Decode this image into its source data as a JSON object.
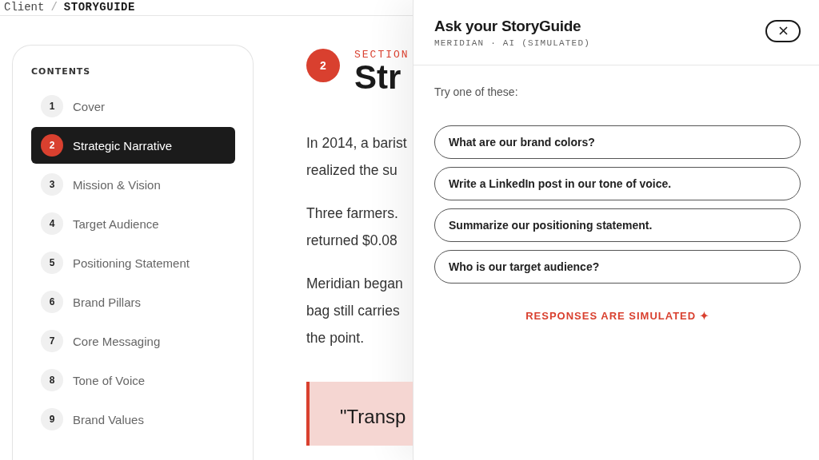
{
  "breadcrumb": {
    "parent": "Client",
    "separator": "/",
    "current": "STORYGUIDE"
  },
  "contents": {
    "title": "CONTENTS",
    "items": [
      {
        "number": "1",
        "label": "Cover",
        "selected": false
      },
      {
        "number": "2",
        "label": "Strategic Narrative",
        "selected": true
      },
      {
        "number": "3",
        "label": "Mission & Vision",
        "selected": false
      },
      {
        "number": "4",
        "label": "Target Audience",
        "selected": false
      },
      {
        "number": "5",
        "label": "Positioning Statement",
        "selected": false
      },
      {
        "number": "6",
        "label": "Brand Pillars",
        "selected": false
      },
      {
        "number": "7",
        "label": "Core Messaging",
        "selected": false
      },
      {
        "number": "8",
        "label": "Tone of Voice",
        "selected": false
      },
      {
        "number": "9",
        "label": "Brand Values",
        "selected": false
      }
    ]
  },
  "section": {
    "number": "2",
    "eyebrow": "SECTION",
    "title": "Str",
    "paragraphs": [
      [
        "In 2014, a barist",
        "realized the su"
      ],
      [
        "Three farmers.",
        "returned $0.08"
      ],
      [
        "Meridian began",
        "bag still carries",
        "the point."
      ]
    ],
    "quote": "\"Transp"
  },
  "assistant": {
    "title": "Ask your StoryGuide",
    "subtitle": "MERIDIAN · AI (SIMULATED)",
    "prompt": "Try one of these:",
    "suggestions": [
      "What are our brand colors?",
      "Write a LinkedIn post in our tone of voice.",
      "Summarize our positioning statement.",
      "Who is our target audience?"
    ],
    "note": "RESPONSES ARE SIMULATED ✦"
  }
}
